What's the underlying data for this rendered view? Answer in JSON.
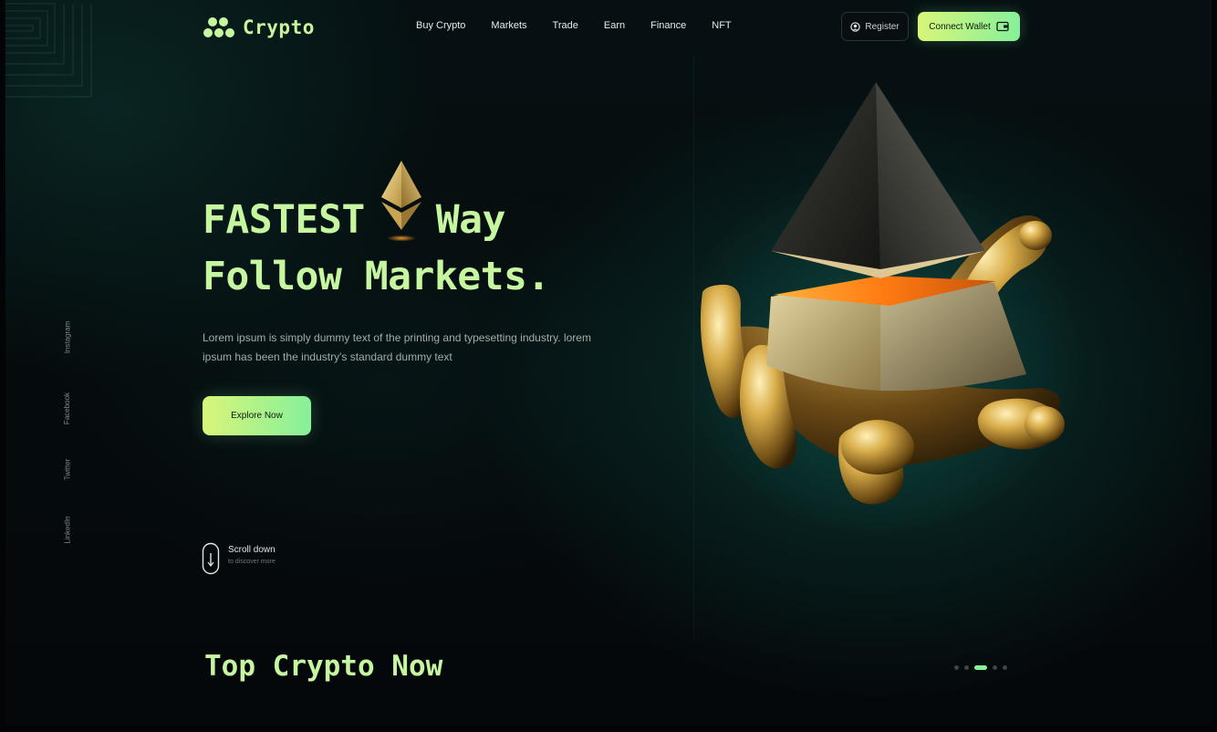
{
  "brand": {
    "name": "Crypto",
    "accent": "#c6f69f",
    "button_gradient": [
      "#d9f57a",
      "#86f09a"
    ],
    "background": "#05080a"
  },
  "nav": {
    "items": [
      "Buy Crypto",
      "Markets",
      "Trade",
      "Earn",
      "Finance",
      "NFT"
    ]
  },
  "header": {
    "register_label": "Register",
    "register_icon": "user-circle-icon",
    "connect_label": "Connect Wallet",
    "connect_icon": "wallet-icon"
  },
  "social": {
    "items": [
      "Instagram",
      "Facebook",
      "Twitter",
      "LinkedIn"
    ]
  },
  "hero": {
    "title_word_1": "FASTEST",
    "title_word_2": "Way",
    "title_line_2": "Follow Markets.",
    "description": "Lorem ipsum is simply dummy text of the printing and typesetting industry. lorem ipsum has been the industry's standard dummy text",
    "cta_label": "Explore Now",
    "inline_icon": "ethereum-icon",
    "art": "gold-hand-holding-ethereum"
  },
  "scroll": {
    "title": "Scroll down",
    "subtitle": "to discover more",
    "icon": "mouse-icon"
  },
  "section": {
    "title": "Top Crypto Now"
  },
  "carousel": {
    "dot_count": 5,
    "active_index": 2
  }
}
